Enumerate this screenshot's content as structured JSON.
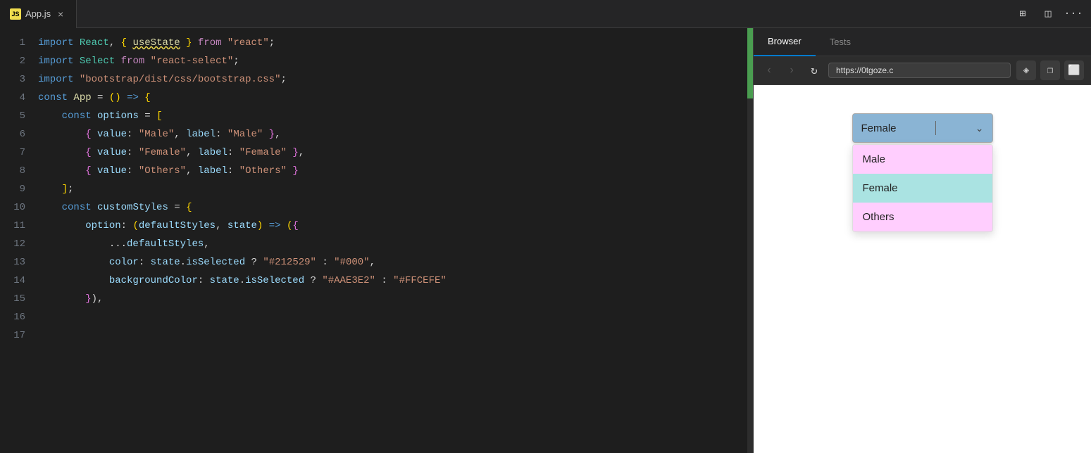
{
  "topbar": {
    "tab_label": "App.js",
    "tab_js_badge": "JS",
    "close_symbol": "×"
  },
  "toolbar_icons": {
    "layout1": "⊞",
    "layout2": "◫",
    "more": "···"
  },
  "browser": {
    "tab_browser": "Browser",
    "tab_tests": "Tests",
    "back_btn": "‹",
    "forward_btn": "›",
    "refresh_btn": "↻",
    "url": "https://0tgoze.c",
    "action1": "◈",
    "action2": "❐",
    "action3": "⬜"
  },
  "select": {
    "selected_value": "Female",
    "separator": "|",
    "arrow": "˅",
    "options": [
      {
        "label": "Male",
        "class": "male"
      },
      {
        "label": "Female",
        "class": "female"
      },
      {
        "label": "Others",
        "class": "others"
      }
    ]
  },
  "code": {
    "lines": [
      {
        "num": "1",
        "html": "<span class='import-kw'>import</span> <span class='react'>React</span>, <span class='arr-bracket'>{</span> <span class='hook underline'>useState</span> <span class='arr-bracket'>}</span> <span class='from-kw'>from</span> <span class='str3'>\"react\"</span>;"
      },
      {
        "num": "2",
        "html": "<span class='import-kw'>import</span> <span class='react'>Select</span> <span class='from-kw'>from</span> <span class='str3'>\"react-select\"</span>;"
      },
      {
        "num": "3",
        "html": "<span class='import-kw'>import</span> <span class='str3'>\"bootstrap/dist/css/bootstrap.css\"</span>;"
      },
      {
        "num": "4",
        "html": ""
      },
      {
        "num": "5",
        "html": "<span class='const-kw'>const</span> <span class='fn'>App</span> <span class='op'>=</span> <span class='arr-bracket'>()</span> <span class='arrow'>=&gt;</span> <span class='arr-bracket'>{</span>"
      },
      {
        "num": "6",
        "html": "    <span class='const-kw'>const</span> <span class='var-name'>options</span> <span class='op'>=</span> <span class='arr-bracket'>[</span>"
      },
      {
        "num": "7",
        "html": "        <span class='obj-bracket'>{</span> <span class='prop-name'>value</span>: <span class='str-val'>\"Male\"</span>, <span class='prop-name'>label</span>: <span class='str-val'>\"Male\"</span> <span class='obj-bracket'>}</span>,"
      },
      {
        "num": "8",
        "html": "        <span class='obj-bracket'>{</span> <span class='prop-name'>value</span>: <span class='str-val'>\"Female\"</span>, <span class='prop-name'>label</span>: <span class='str-val'>\"Female\"</span> <span class='obj-bracket'>}</span>,"
      },
      {
        "num": "9",
        "html": "        <span class='obj-bracket'>{</span> <span class='prop-name'>value</span>: <span class='str-val'>\"Others\"</span>, <span class='prop-name'>label</span>: <span class='str-val'>\"Others\"</span> <span class='obj-bracket'>}</span>"
      },
      {
        "num": "10",
        "html": "    <span class='arr-bracket'>]</span>;"
      },
      {
        "num": "11",
        "html": "    <span class='const-kw'>const</span> <span class='var-name'>customStyles</span> <span class='op'>=</span> <span class='arr-bracket'>{</span>"
      },
      {
        "num": "12",
        "html": "        <span class='prop-name'>option</span>: <span class='arr-bracket'>(</span><span class='var-name'>defaultStyles</span>, <span class='var-name'>state</span><span class='arr-bracket'>)</span> <span class='arrow'>=&gt;</span> <span class='arr-bracket'>(</span><span class='obj-bracket'>{</span>"
      },
      {
        "num": "13",
        "html": "            ...<span class='var-name'>defaultStyles</span>,"
      },
      {
        "num": "14",
        "html": "            <span class='prop-name'>color</span>: <span class='var-name'>state</span>.<span class='var-name'>isSelected</span> <span class='op'>?</span> <span class='str-val'>\"#212529\"</span> : <span class='str-val'>\"#000\"</span>,"
      },
      {
        "num": "15",
        "html": "            <span class='prop-name'>backgroundColor</span>: <span class='var-name'>state</span>.<span class='var-name'>isSelected</span> <span class='op'>?</span> <span class='str-val'>\"#AAE3E2\"</span> : <span class='str-val'>\"#FFCEFE\"</span>"
      },
      {
        "num": "16",
        "html": "        <span class='obj-bracket'>}</span>),"
      },
      {
        "num": "17",
        "html": ""
      }
    ]
  }
}
